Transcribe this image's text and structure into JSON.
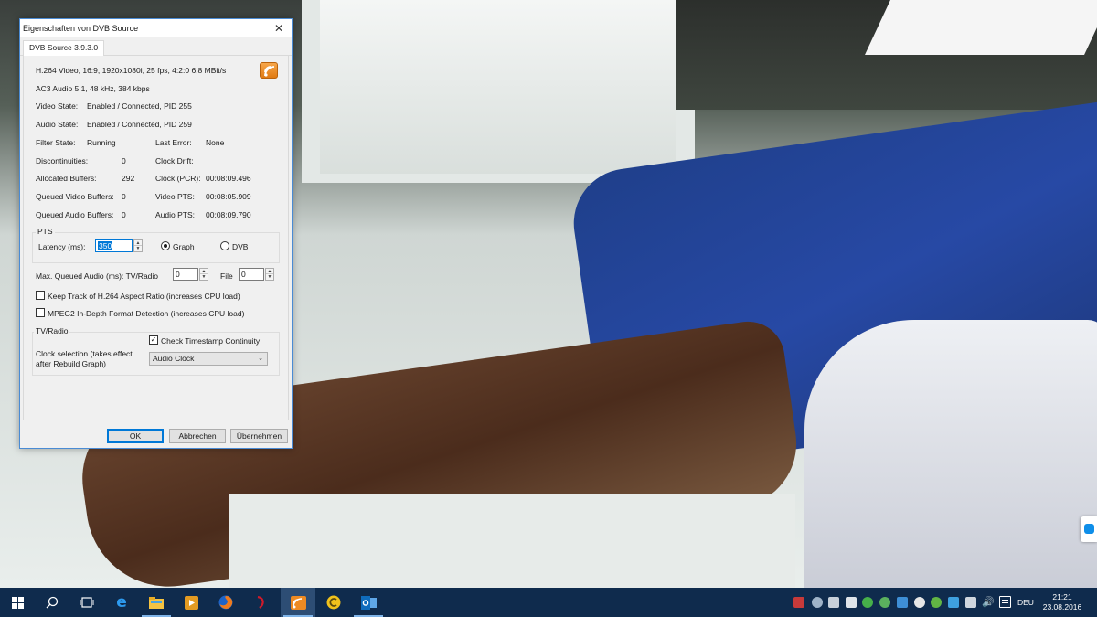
{
  "dialog": {
    "title": "Eigenschaften von DVB Source",
    "tab": "DVB Source 3.9.3.0",
    "info": {
      "video": "H.264 Video, 16:9, 1920x1080i, 25 fps, 4:2:0   6,8 MBit/s",
      "audio": "AC3 Audio 5.1, 48 kHz, 384 kbps",
      "video_state_label": "Video State:",
      "video_state": "Enabled / Connected, PID 255",
      "audio_state_label": "Audio State:",
      "audio_state": "Enabled / Connected, PID 259"
    },
    "stats": {
      "filter_state_label": "Filter State:",
      "filter_state": "Running",
      "last_error_label": "Last Error:",
      "last_error": "None",
      "discontinuities_label": "Discontinuities:",
      "discontinuities": "0",
      "clock_drift_label": "Clock Drift:",
      "clock_drift": "",
      "allocated_buffers_label": "Allocated Buffers:",
      "allocated_buffers": "292",
      "clock_pcr_label": "Clock (PCR):",
      "clock_pcr": "00:08:09.496",
      "queued_video_label": "Queued Video Buffers:",
      "queued_video": "0",
      "video_pts_label": "Video PTS:",
      "video_pts": "00:08:05.909",
      "queued_audio_label": "Queued Audio Buffers:",
      "queued_audio": "0",
      "audio_pts_label": "Audio PTS:",
      "audio_pts": "00:08:09.790"
    },
    "pts": {
      "group_label": "PTS",
      "latency_label": "Latency (ms):",
      "latency_value": "350",
      "radio_graph": "Graph",
      "radio_dvb": "DVB",
      "selected": "Graph"
    },
    "queued_audio": {
      "label": "Max. Queued Audio (ms): TV/Radio",
      "tv_radio_value": "0",
      "file_label": "File",
      "file_value": "0"
    },
    "checkboxes": {
      "aspect_label": "Keep Track of H.264 Aspect Ratio (increases CPU load)",
      "aspect_checked": false,
      "mpeg2_label": "MPEG2 In-Depth Format Detection (increases CPU load)",
      "mpeg2_checked": false
    },
    "tv_radio": {
      "group_label": "TV/Radio",
      "timestamp_label": "Check Timestamp Continuity",
      "timestamp_checked": true,
      "clock_label_1": "Clock selection (takes effect",
      "clock_label_2": "after Rebuild Graph)",
      "clock_value": "Audio Clock"
    },
    "buttons": {
      "ok": "OK",
      "cancel": "Abbrechen",
      "apply": "Übernehmen"
    }
  },
  "taskbar": {
    "apps": [
      "start-icon",
      "search-icon",
      "task-view-icon",
      "edge-icon",
      "file-explorer-icon",
      "media-player-icon",
      "firefox-icon",
      "app-red-icon",
      "dvb-source-icon",
      "app-yellow-icon",
      "outlook-icon"
    ],
    "active_app": "dvb-source-icon",
    "language": "DEU",
    "time": "21:21",
    "date": "23.08.2016"
  },
  "colors": {
    "taskbar": "#0f2b4d",
    "accent": "#0078d7",
    "dialog_bg": "#f0f0f0"
  }
}
